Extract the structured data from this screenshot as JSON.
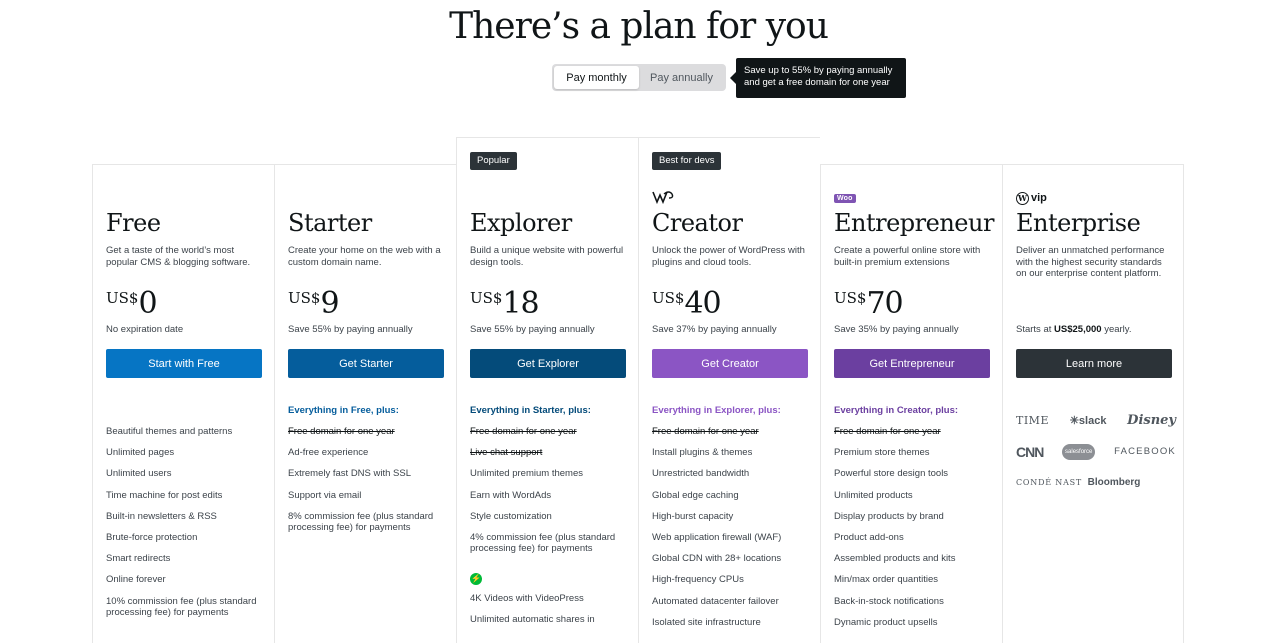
{
  "header": {
    "title": "There’s a plan for you",
    "toggle": {
      "monthly": "Pay monthly",
      "annually": "Pay annually"
    },
    "tooltip": "Save up to 55% by paying annually and get a free domain for one year"
  },
  "plans": [
    {
      "name": "Free",
      "desc": "Get a taste of the world’s most popular CMS & blogging software.",
      "currency": "US$",
      "amount": "0",
      "note": "No expiration date",
      "cta": "Start with Free",
      "cta_color": "#0675c4",
      "features_heading": "",
      "features": [
        "Beautiful themes and patterns",
        "Unlimited pages",
        "Unlimited users",
        "Time machine for post edits",
        "Built-in newsletters & RSS",
        "Brute-force protection",
        "Smart redirects",
        "Online forever",
        "10% commission fee (plus standard processing fee) for payments"
      ]
    },
    {
      "name": "Starter",
      "desc": "Create your home on the web with a custom domain name.",
      "currency": "US$",
      "amount": "9",
      "note": "Save 55% by paying annually",
      "cta": "Get Starter",
      "cta_color": "#055d9c",
      "features_heading": "Everything in Free, plus:",
      "heading_color": "#055d9c",
      "features": [
        "Free domain for one year",
        "Ad-free experience",
        "Extremely fast DNS with SSL",
        "Support via email",
        "8% commission fee (plus standard processing fee) for payments"
      ]
    },
    {
      "badge": "Popular",
      "name": "Explorer",
      "desc": "Build a unique website with powerful design tools.",
      "currency": "US$",
      "amount": "18",
      "note": "Save 55% by paying annually",
      "cta": "Get Explorer",
      "cta_color": "#044b7a",
      "features_heading": "Everything in Starter, plus:",
      "heading_color": "#044b7a",
      "features": [
        "Free domain for one year",
        "Live chat support",
        "Unlimited premium themes",
        "Earn with WordAds",
        "Style customization",
        "4% commission fee (plus standard processing fee) for payments",
        "4K Videos with VideoPress",
        "Unlimited automatic shares in"
      ],
      "icon": "bolt-icon"
    },
    {
      "badge": "Best for devs",
      "name": "Creator",
      "desc": "Unlock the power of WordPress with plugins and cloud tools.",
      "currency": "US$",
      "amount": "40",
      "note": "Save 37% by paying annually",
      "cta": "Get Creator",
      "cta_color": "#8b55c4",
      "features_heading": "Everything in Explorer, plus:",
      "heading_color": "#8b55c4",
      "features": [
        "Free domain for one year",
        "Install plugins & themes",
        "Unrestricted bandwidth",
        "Global edge caching",
        "High-burst capacity",
        "Web application firewall (WAF)",
        "Global CDN with 28+ locations",
        "High-frequency CPUs",
        "Automated datacenter failover",
        "Isolated site infrastructure"
      ]
    },
    {
      "brand": "Woo",
      "name": "Entrepreneur",
      "desc": "Create a powerful online store with built-in premium extensions",
      "currency": "US$",
      "amount": "70",
      "note": "Save 35% by paying annually",
      "cta": "Get Entrepreneur",
      "cta_color": "#6b3fa0",
      "features_heading": "Everything in Creator, plus:",
      "heading_color": "#6b3fa0",
      "features": [
        "Free domain for one year",
        "Premium store themes",
        "Powerful store design tools",
        "Unlimited products",
        "Display products by brand",
        "Product add-ons",
        "Assembled products and kits",
        "Min/max order quantities",
        "Back-in-stock notifications",
        "Dynamic product upsells"
      ]
    },
    {
      "brand": "vip",
      "name": "Enterprise",
      "desc": "Deliver an unmatched performance with the highest security standards on our enterprise content platform.",
      "note_prefix": "Starts at ",
      "note_bold": "US$25,000",
      "note_suffix": " yearly.",
      "cta": "Learn more",
      "cta_color": "#2c3338",
      "logos": [
        "TIME",
        "slack",
        "Disney",
        "CNN",
        "salesforce",
        "FACEBOOK",
        "CONDÉ NAST",
        "Bloomberg"
      ]
    }
  ]
}
